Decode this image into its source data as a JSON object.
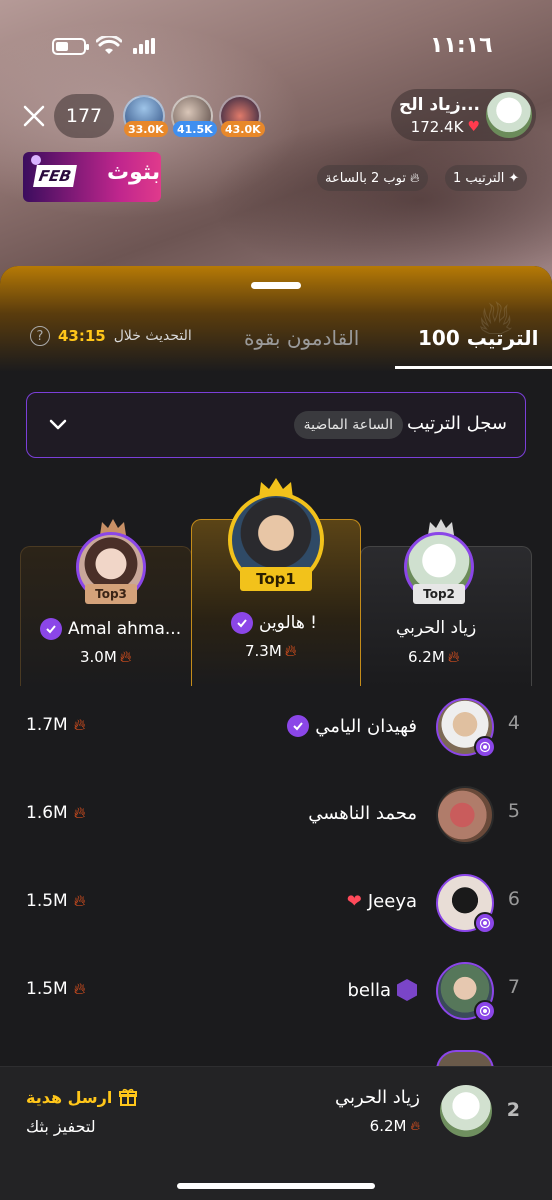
{
  "status_bar": {
    "time": "١١:١٦"
  },
  "stream": {
    "viewer_count": "177",
    "viewers": [
      {
        "badge": "33.0K",
        "badge_color": "#e8882a"
      },
      {
        "badge": "41.5K",
        "badge_color": "#3f8ff0"
      },
      {
        "badge": "43.0K",
        "badge_color": "#e8882a"
      }
    ],
    "host": {
      "name": "زياد الح...",
      "likes": "172.4K"
    },
    "banner": {
      "tag": "FEB",
      "text": "بثوث"
    },
    "chips": {
      "hourly": "توب 2 بالساعة",
      "rank": "الترتيب 1"
    }
  },
  "sheet": {
    "tabs": {
      "top100": "الترتيب 100",
      "rising": "القادمون بقوة"
    },
    "refresh": {
      "label": "التحديث خلال",
      "timer": "43:15",
      "help": "?"
    },
    "history": {
      "title": "سجل الترتيب",
      "period": "الساعة الماضية"
    },
    "podium": {
      "first": {
        "rank": "Top1",
        "name": "هالوين !",
        "score": "7.3M"
      },
      "second": {
        "rank": "Top2",
        "name": "زياد الحربي",
        "score": "6.2M"
      },
      "third": {
        "rank": "Top3",
        "name": "Amal ahma...",
        "score": "3.0M"
      }
    },
    "list": [
      {
        "rank": "4",
        "name": "فهيدان اليامي",
        "score": "1.7M"
      },
      {
        "rank": "5",
        "name": "محمد الناهسي",
        "score": "1.6M"
      },
      {
        "rank": "6",
        "name": "Jeeya",
        "score": "1.5M"
      },
      {
        "rank": "7",
        "name": "bella",
        "score": "1.5M"
      }
    ],
    "me": {
      "rank": "2",
      "name": "زياد الحربي",
      "score": "6.2M",
      "gift_label": "ارسل هدية",
      "gift_sub": "لتحفيز بثك"
    }
  },
  "colors": {
    "accent_purple": "#8b46e8",
    "gold": "#ffc61a",
    "fire": "#ff5a1f"
  }
}
